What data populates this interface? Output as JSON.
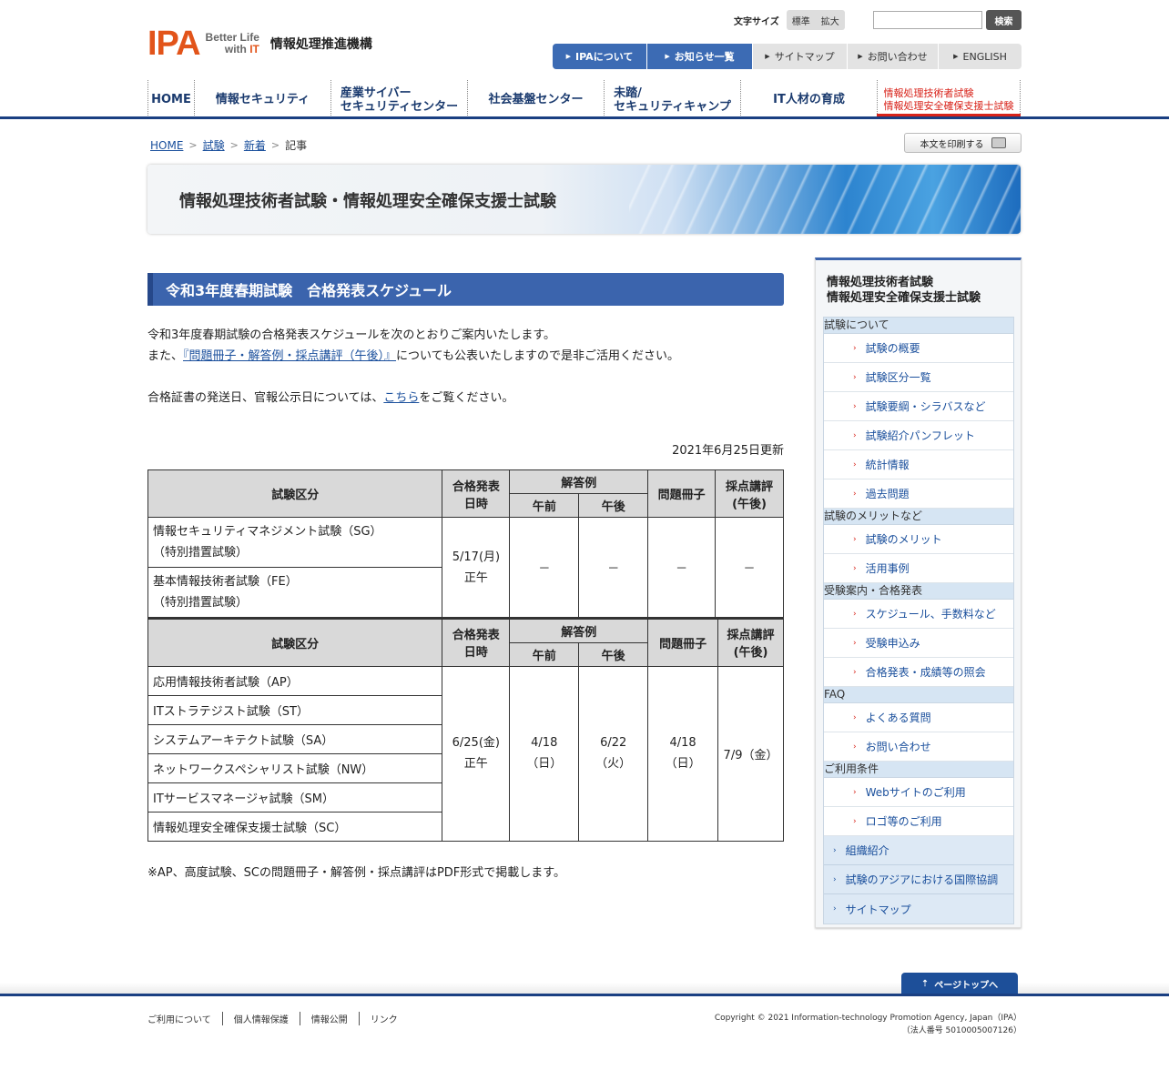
{
  "header": {
    "logo": "IPA",
    "tagline1": "Better Life",
    "tagline2": "with",
    "tagline_it": "IT",
    "org": "情報処理推進機構",
    "fontsize_label": "文字サイズ",
    "fontsize_std": "標準",
    "fontsize_large": "拡大",
    "search_button": "検索",
    "search_value": "",
    "utility_nav": [
      "IPAについて",
      "お知らせ一覧",
      "サイトマップ",
      "お問い合わせ",
      "ENGLISH"
    ]
  },
  "global_nav": {
    "home": "HOME",
    "security": "情報セキュリティ",
    "ics1": "産業サイバー",
    "ics2": "セキュリティセンター",
    "infra": "社会基盤センター",
    "camp1": "未踏/",
    "camp2": "セキュリティキャンプ",
    "hr": "IT人材の育成",
    "exam1": "情報処理技術者試験",
    "exam2": "情報処理安全確保支援士試験"
  },
  "breadcrumb": [
    "HOME",
    "試験",
    "新着",
    "記事"
  ],
  "print_label": "本文を印刷する",
  "banner_title": "情報処理技術者試験・情報処理安全確保支援士試験",
  "article": {
    "title": "令和3年度春期試験　合格発表スケジュール",
    "line1": "令和3年度春期試験の合格発表スケジュールを次のとおりご案内いたします。",
    "line2_pre": "また、",
    "line2_link": "『問題冊子・解答例・採点講評（午後）』",
    "line2_post": "についても公表いたしますので是非ご活用ください。",
    "line3_pre": "合格証書の発送日、官報公示日については、",
    "line3_link": "こちら",
    "line3_post": "をご覧ください。",
    "updated": "2021年6月25日更新",
    "note": "※AP、高度試験、SCの問題冊子・解答例・採点講評はPDF形式で掲載します。"
  },
  "table": {
    "h_exam": "試験区分",
    "h_result1": "合格発表",
    "h_result2": "日時",
    "h_answer": "解答例",
    "h_am": "午前",
    "h_pm": "午後",
    "h_book": "問題冊子",
    "h_review1": "採点講評",
    "h_review2": "(午後)",
    "t1_rows": [
      [
        "情報セキュリティマネジメント試験（SG）",
        "（特別措置試験）"
      ],
      [
        "基本情報技術者試験（FE）",
        "（特別措置試験）"
      ]
    ],
    "t1_date1": "5/17(月)",
    "t1_date2": "正午",
    "t1_dash": "－",
    "t2_rows": [
      "応用情報技術者試験（AP）",
      "ITストラテジスト試験（ST）",
      "システムアーキテクト試験（SA）",
      "ネットワークスペシャリスト試験（NW）",
      "ITサービスマネージャ試験（SM）",
      "情報処理安全確保支援士試験（SC）"
    ],
    "t2_date1": "6/25(金)",
    "t2_date2": "正午",
    "t2_am1": "4/18",
    "t2_am2": "（日）",
    "t2_pm1": "6/22",
    "t2_pm2": "（火）",
    "t2_book1": "4/18",
    "t2_book2": "（日）",
    "t2_review": "7/9（金）"
  },
  "sidebar": {
    "title1": "情報処理技術者試験",
    "title2": "情報処理安全確保支援士試験",
    "cat1": "試験について",
    "cat1_items": [
      "試験の概要",
      "試験区分一覧",
      "試験要綱・シラバスなど",
      "試験紹介パンフレット",
      "統計情報",
      "過去問題"
    ],
    "cat2": "試験のメリットなど",
    "cat2_items": [
      "試験のメリット",
      "活用事例"
    ],
    "cat3": "受験案内・合格発表",
    "cat3_items": [
      "スケジュール、手数料など",
      "受験申込み",
      "合格発表・成績等の照会"
    ],
    "cat4": "FAQ",
    "cat4_items": [
      "よくある質問",
      "お問い合わせ"
    ],
    "cat5": "ご利用条件",
    "cat5_items": [
      "Webサイトのご利用",
      "ロゴ等のご利用"
    ],
    "bottom_items": [
      "組織紹介",
      "試験のアジアにおける国際協調",
      "サイトマップ"
    ]
  },
  "footer": {
    "pagetop": "ページトップへ",
    "links": [
      "ご利用について",
      "個人情報保護",
      "情報公開",
      "リンク"
    ],
    "copyright": "Copyright © 2021 Information-technology Promotion Agency, Japan（IPA）",
    "corp_no": "（法人番号 5010005007126）"
  }
}
